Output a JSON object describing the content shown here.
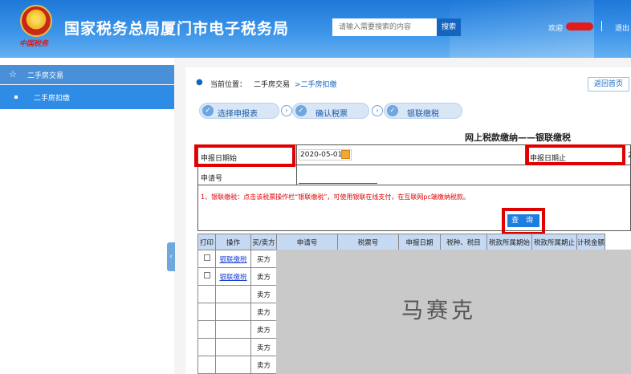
{
  "header": {
    "title": "国家税务总局厦门市电子税务局",
    "brand_script": "中国税务",
    "search_placeholder": "请输入需要搜索的内容",
    "search_button": "搜索",
    "welcome": "欢迎",
    "logout": "退出"
  },
  "sidebar": {
    "group_label": "二手房交易",
    "item_label": "二手房扣缴"
  },
  "breadcrumb": {
    "prefix": "当前位置：",
    "level1": "二手房交易",
    "level2": ">二手房扣缴"
  },
  "back_home": "返回首页",
  "steps": [
    "选择申报表",
    "确认税票",
    "银联缴税"
  ],
  "form": {
    "title": "网上税款缴纳——银联缴税",
    "date_start_label": "申报日期始",
    "date_start_value": "2020-05-01",
    "date_end_label": "申报日期止",
    "date_end_partial": "2",
    "app_no_label": "申请号",
    "note": "1、银联缴税：点击该税票操作栏“银联缴税”，可使用银联在线支付，在互联网pc端缴纳税款。",
    "query_button": "查 询"
  },
  "table": {
    "headers": [
      "打印",
      "操作",
      "买/卖方",
      "申请号",
      "税票号",
      "申报日期",
      "税种、税目",
      "税款所属期始",
      "税款所属期止",
      "计税金额"
    ],
    "rows": [
      {
        "checkbox": true,
        "action": "银联缴税",
        "party": "买方"
      },
      {
        "checkbox": true,
        "action": "银联缴税",
        "party": "卖方"
      },
      {
        "checkbox": false,
        "action": "",
        "party": "卖方"
      },
      {
        "checkbox": false,
        "action": "",
        "party": "卖方"
      },
      {
        "checkbox": false,
        "action": "",
        "party": "卖方"
      },
      {
        "checkbox": false,
        "action": "",
        "party": "卖方"
      },
      {
        "checkbox": false,
        "action": "",
        "party": "卖方"
      }
    ]
  },
  "watermark": "马赛克",
  "colors": {
    "header_blue": "#2e86e0",
    "accent_red": "#e00000",
    "table_header": "#c5daf2",
    "link_blue": "#1b3fd6"
  }
}
